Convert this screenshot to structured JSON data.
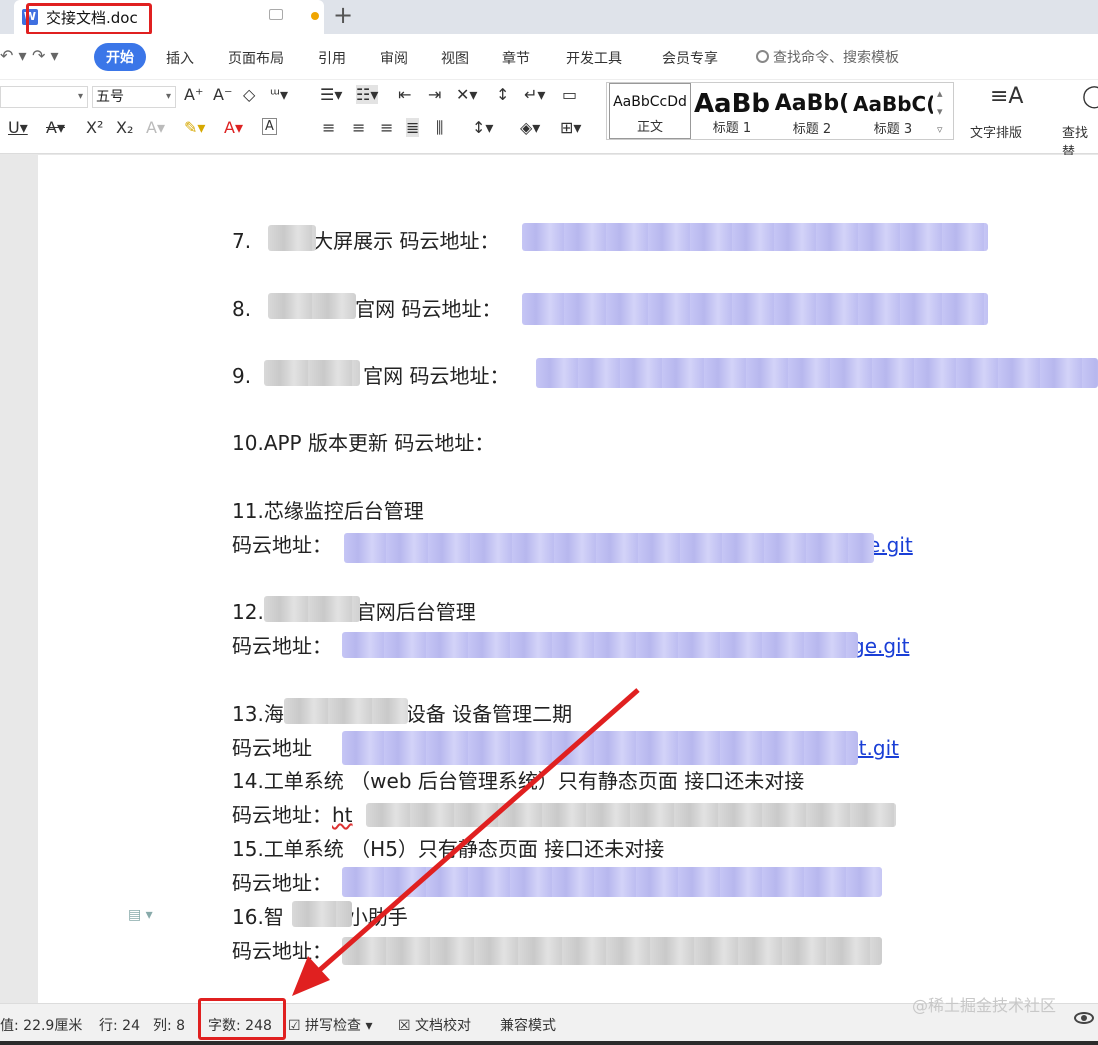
{
  "tab": {
    "icon_letter": "W",
    "title": "交接文档.doc"
  },
  "menu": {
    "undo": "↶ ▾",
    "redo": "↷ ▾",
    "items": [
      "开始",
      "插入",
      "页面布局",
      "引用",
      "审阅",
      "视图",
      "章节",
      "开发工具",
      "会员专享"
    ],
    "search_placeholder": "查找命令、搜索模板"
  },
  "ribbon": {
    "font_size": "五号",
    "style_samples": [
      "AaBbCcDd",
      "AaBb",
      "AaBb(",
      "AaBbC("
    ],
    "style_labels": [
      "正文",
      "标题 1",
      "标题 2",
      "标题 3"
    ],
    "text_layout": "文字排版",
    "find": "查找替"
  },
  "document": {
    "lines": [
      {
        "num": "7.",
        "label": "大屏展示  码云地址："
      },
      {
        "num": "8.",
        "label": "官网  码云地址："
      },
      {
        "num": "9.",
        "label": "官网  码云地址："
      },
      {
        "num": "10.",
        "label": "APP 版本更新  码云地址："
      },
      {
        "num": "11.",
        "label": "芯缘监控后台管理"
      },
      {
        "label": "码云地址：",
        "link_tail": "e.git"
      },
      {
        "num": "12.",
        "label": "官网后台管理"
      },
      {
        "label": "码云地址：",
        "link_tail": "ge.git"
      },
      {
        "num": "13.",
        "label_head": "海",
        "label": "设备  设备管理二期"
      },
      {
        "label": "码云地址",
        "link_tail": "nt.git"
      },
      {
        "num": "14.",
        "label": "工单系统  （web 后台管理系统）只有静态页面    接口还未对接"
      },
      {
        "label": "码云地址：",
        "link_head": "ht"
      },
      {
        "num": "15.",
        "label": "工单系统  （H5）只有静态页面    接口还未对接"
      },
      {
        "label": "码云地址："
      },
      {
        "num": "16.",
        "label_head": "智",
        "label": "小助手"
      },
      {
        "label": "码云地址："
      }
    ]
  },
  "status": {
    "position": "值: 22.9厘米",
    "row": "行: 24",
    "col": "列: 8",
    "word_count": "字数: 248",
    "spell": "拼写检查",
    "proofread": "文档校对",
    "compat": "兼容模式"
  },
  "watermark": "@稀土掘金技术社区",
  "colors": {
    "accent": "#3b76e8",
    "highlight": "#e02020",
    "link": "#1a3fd6"
  }
}
